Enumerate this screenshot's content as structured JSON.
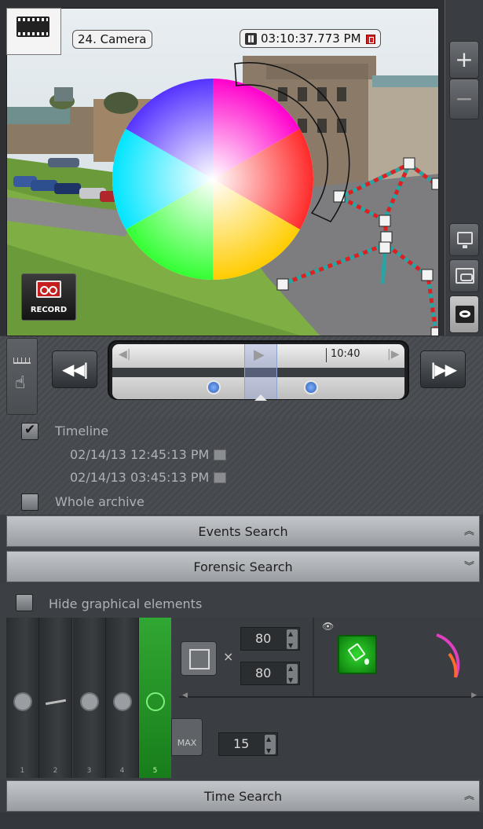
{
  "camera": {
    "name": "24. Camera",
    "time": "03:10:37.773 PM",
    "record_label": "RECORD"
  },
  "side_controls": {
    "zoom_in": "+",
    "zoom_out": "−"
  },
  "playback": {
    "prev_label": "◀◀|",
    "next_label": "|▶▶",
    "timeline_time": "10:40"
  },
  "options": {
    "timeline_label": "Timeline",
    "timeline_checked": true,
    "start_datetime": "02/14/13 12:45:13 PM",
    "end_datetime": "02/14/13 03:45:13 PM",
    "whole_archive_label": "Whole archive",
    "whole_archive_checked": false
  },
  "sections": {
    "events_search": "Events Search",
    "forensic_search": "Forensic Search",
    "time_search": "Time Search"
  },
  "forensic": {
    "hide_label": "Hide graphical elements",
    "tools": [
      {
        "number": "1",
        "icon": "arrow-circle-icon"
      },
      {
        "number": "2",
        "icon": "line-cross-icon"
      },
      {
        "number": "3",
        "icon": "clock-icon"
      },
      {
        "number": "4",
        "icon": "dots-circle-icon"
      },
      {
        "number": "5",
        "icon": "color-search-icon"
      }
    ],
    "width_value": "80",
    "height_value": "80",
    "count_value": "15",
    "max_label": "MAX",
    "times_symbol": "×"
  },
  "colors": {
    "accent_green": "#2ea52f",
    "path_red": "#e02020",
    "path_teal": "#2aa3a3"
  }
}
